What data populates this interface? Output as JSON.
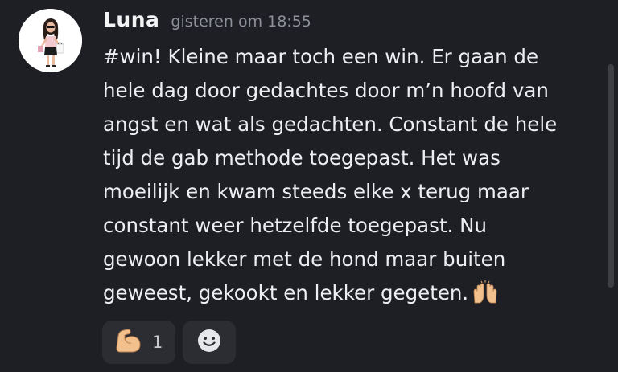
{
  "message": {
    "username": "Luna",
    "timestamp": "gisteren om 18:55",
    "text": "#win! Kleine maar toch een win. Er gaan de\nhele dag door gedachtes door m’n hoofd van\nangst en wat als gedachten. Constant de hele\ntijd de gab methode toegepast. Het was\nmoeilijk en kwam steeds elke x terug maar\nconstant weer hetzelfde toegepast. Nu\ngewoon lekker met de hond maar buiten\ngeweest, gekookt en lekker gegeten.",
    "trailing_emoji": "raised-hands"
  },
  "reactions": [
    {
      "emoji": "flexed-biceps",
      "count": "1"
    }
  ],
  "add_reaction_icon": "smiley-add-reaction-icon",
  "colors": {
    "background": "#1e1f24",
    "reaction_bg": "#2b2d33",
    "timestamp": "#8e9199"
  }
}
